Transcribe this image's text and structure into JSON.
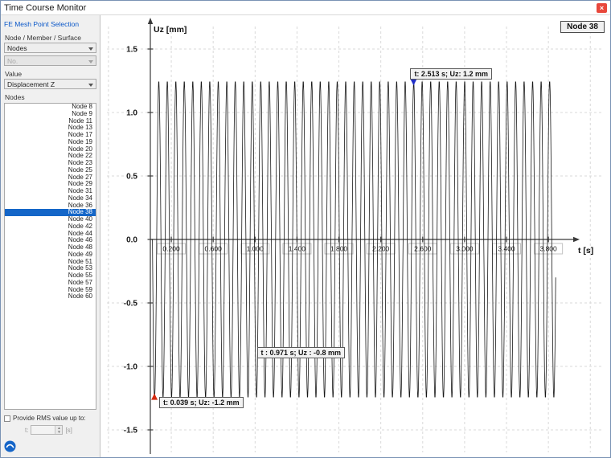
{
  "window": {
    "title": "Time Course Monitor",
    "close_label": "×"
  },
  "sidebar": {
    "section_title": "FE Mesh Point Selection",
    "node_member_surface_label": "Node / Member / Surface",
    "node_type_value": "Nodes",
    "number_placeholder": "No.",
    "value_label": "Value",
    "value_value": "Displacement Z",
    "nodes_label": "Nodes",
    "nodes": [
      "Node 8",
      "Node 9",
      "Node 11",
      "Node 13",
      "Node 17",
      "Node 19",
      "Node 20",
      "Node 22",
      "Node 23",
      "Node 25",
      "Node 27",
      "Node 29",
      "Node 31",
      "Node 34",
      "Node 36",
      "Node 38",
      "Node 40",
      "Node 42",
      "Node 44",
      "Node 46",
      "Node 48",
      "Node 49",
      "Node 51",
      "Node 53",
      "Node 55",
      "Node 57",
      "Node 59",
      "Node 60"
    ],
    "selected_node": "Node 38",
    "rms_checkbox_label": "Provide RMS value up to:",
    "rms_t_label": "t:",
    "rms_unit_label": "[s]"
  },
  "chart": {
    "node_badge": "Node 38",
    "y_axis_label": "Uz [mm]",
    "x_axis_label": "t [s]"
  },
  "chart_data": {
    "type": "line",
    "title": "Node 38",
    "xlabel": "t [s]",
    "ylabel": "Uz [mm]",
    "xlim": [
      -0.45,
      4.35
    ],
    "ylim": [
      -1.75,
      1.75
    ],
    "grid": true,
    "x_ticks": [
      0.2,
      0.6,
      1.0,
      1.4,
      1.8,
      2.2,
      2.6,
      3.0,
      3.4,
      3.8
    ],
    "x_tick_labels": [
      "0.200",
      "0.600",
      "1.000",
      "1.400",
      "1.800",
      "2.200",
      "2.600",
      "3.000",
      "3.400",
      "3.800"
    ],
    "x_grid_ticks": [
      -0.4,
      0.2,
      0.6,
      1.0,
      1.4,
      1.8,
      2.2,
      2.6,
      3.0,
      3.4,
      3.8,
      4.2
    ],
    "y_ticks": [
      1.5,
      1.0,
      0.5,
      0.0,
      -0.5,
      -1.0,
      -1.5
    ],
    "y_tick_labels": [
      "1.5",
      "1.0",
      "0.5",
      "0.0",
      "-0.5",
      "-1.0",
      "-1.5"
    ],
    "series": [
      {
        "name": "Uz",
        "waveform": "sine",
        "amplitude_mm": 1.25,
        "frequency_hz": 12.33,
        "t_start": 0.02,
        "t_end": 3.87,
        "phase_deg": 180
      }
    ],
    "annotations": [
      {
        "label": "t: 2.513 s; Uz: 1.2 mm",
        "t": 2.513,
        "uz": 1.2,
        "marker": "blue-triangle-down",
        "box_dx": -4,
        "box_dy": -23
      },
      {
        "label": "t : 0.971 s; Uz : -0.8 mm",
        "t": 0.971,
        "uz": -0.8,
        "marker": "none",
        "box_dx": 6,
        "box_dy": 8
      },
      {
        "label": "t: 0.039 s; Uz: -1.2 mm",
        "t": 0.039,
        "uz": -1.2,
        "marker": "red-triangle-up",
        "box_dx": 6,
        "box_dy": 6
      }
    ]
  }
}
